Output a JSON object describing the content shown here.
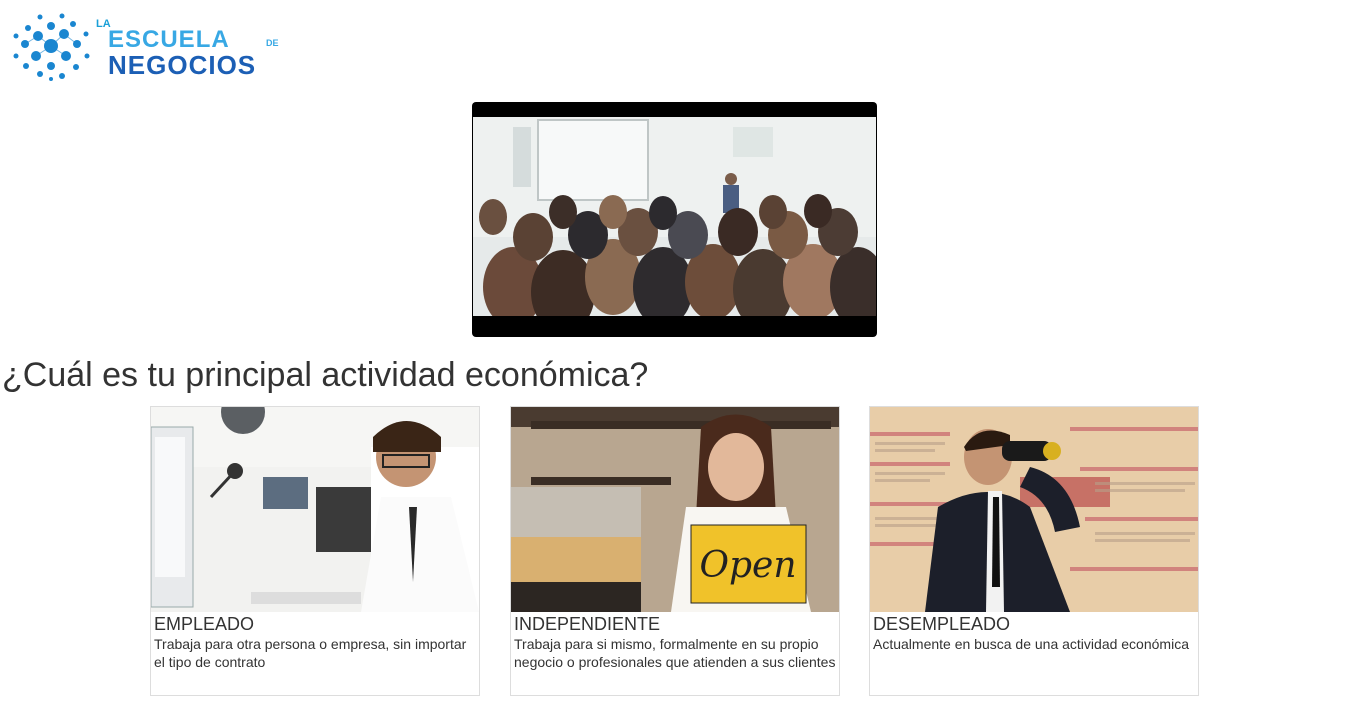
{
  "logo": {
    "la": "LA",
    "escuela": "ESCUELA",
    "de": "DE",
    "negocios": "NEGOCIOS"
  },
  "video": {
    "name": "conference-video"
  },
  "question": "¿Cuál es tu principal actividad económica?",
  "options": [
    {
      "title": "EMPLEADO",
      "description": "Trabaja para otra persona o empresa, sin importar el tipo de contrato"
    },
    {
      "title": "INDEPENDIENTE",
      "description": "Trabaja para si mismo, formalmente en su propio negocio o profesionales que atienden a sus clientes",
      "sign": "Open"
    },
    {
      "title": "DESEMPLEADO",
      "description": "Actualmente en busca de una actividad económica"
    }
  ],
  "colors": {
    "logo_light": "#38a8e4",
    "logo_dark": "#1c5fb5",
    "text": "#333333",
    "border": "#dddddd"
  }
}
